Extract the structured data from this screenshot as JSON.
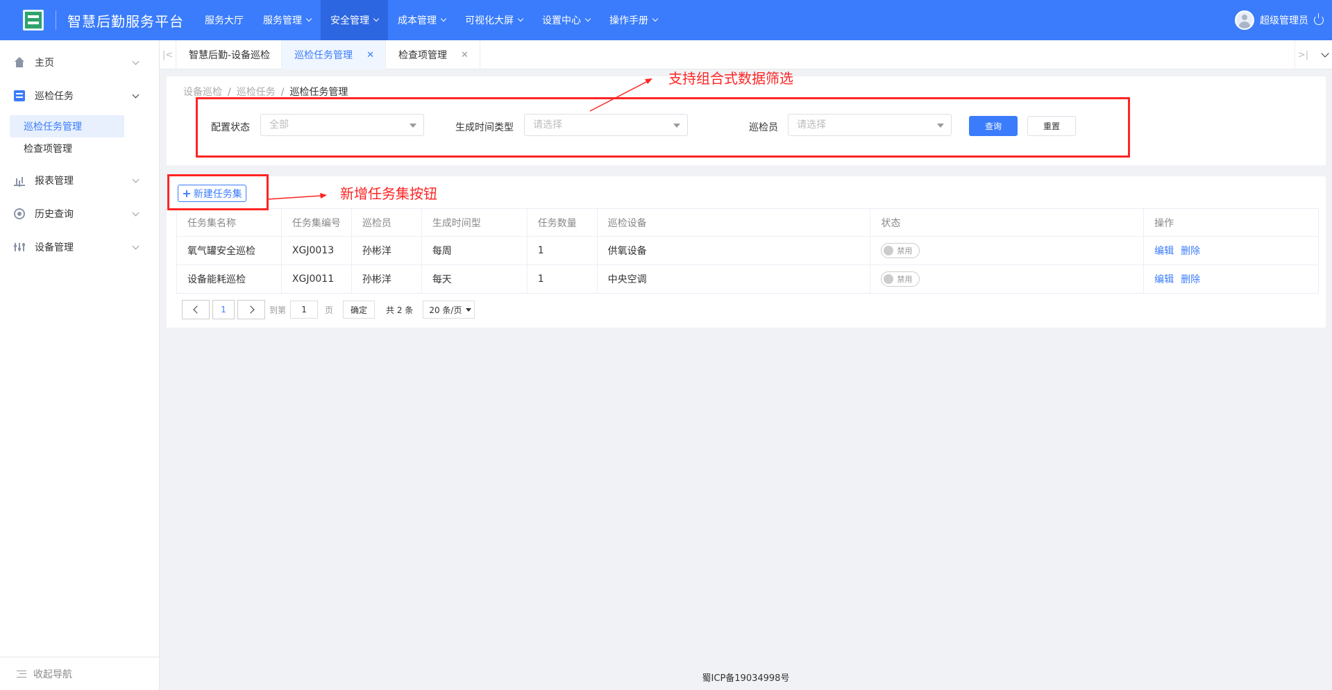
{
  "header": {
    "brand": "智慧后勤服务平台",
    "nav": [
      {
        "label": "服务大厅",
        "dropdown": false,
        "active": false
      },
      {
        "label": "服务管理",
        "dropdown": true,
        "active": false
      },
      {
        "label": "安全管理",
        "dropdown": true,
        "active": true
      },
      {
        "label": "成本管理",
        "dropdown": true,
        "active": false
      },
      {
        "label": "可视化大屏",
        "dropdown": true,
        "active": false
      },
      {
        "label": "设置中心",
        "dropdown": true,
        "active": false
      },
      {
        "label": "操作手册",
        "dropdown": true,
        "active": false
      }
    ],
    "user": "超级管理员",
    "accent_color": "#3a7cfb"
  },
  "sidebar": {
    "items": [
      {
        "label": "主页",
        "icon": "home-icon"
      },
      {
        "label": "巡检任务",
        "icon": "task-icon",
        "open": true,
        "children": [
          {
            "label": "巡检任务管理",
            "active": true
          },
          {
            "label": "检查项管理",
            "active": false
          }
        ]
      },
      {
        "label": "报表管理",
        "icon": "report-icon"
      },
      {
        "label": "历史查询",
        "icon": "history-icon"
      },
      {
        "label": "设备管理",
        "icon": "device-icon"
      }
    ],
    "collapse_label": "收起导航"
  },
  "tabs": [
    {
      "label": "智慧后勤-设备巡检",
      "closable": false,
      "active": false
    },
    {
      "label": "巡检任务管理",
      "closable": true,
      "active": true
    },
    {
      "label": "检查项管理",
      "closable": true,
      "active": false
    }
  ],
  "breadcrumb": [
    "设备巡检",
    "巡检任务",
    "巡检任务管理"
  ],
  "filters": {
    "config_status": {
      "label": "配置状态",
      "value": "全部"
    },
    "time_type": {
      "label": "生成时间类型",
      "placeholder": "请选择"
    },
    "inspector": {
      "label": "巡检员",
      "placeholder": "请选择"
    },
    "query_label": "查询",
    "reset_label": "重置"
  },
  "table": {
    "add_button": "新建任务集",
    "columns": [
      "任务集名称",
      "任务集编号",
      "巡检员",
      "生成时间型",
      "任务数量",
      "巡检设备",
      "状态",
      "操作"
    ],
    "rows": [
      {
        "name": "氧气罐安全巡检",
        "code": "XGJ0013",
        "inspector": "孙彬洋",
        "time_type": "每周",
        "count": "1",
        "device": "供氧设备",
        "status": "禁用",
        "edit": "编辑",
        "delete": "删除"
      },
      {
        "name": "设备能耗巡检",
        "code": "XGJ0011",
        "inspector": "孙彬洋",
        "time_type": "每天",
        "count": "1",
        "device": "中央空调",
        "status": "禁用",
        "edit": "编辑",
        "delete": "删除"
      }
    ]
  },
  "pagination": {
    "current_page": "1",
    "goto_prefix": "到第",
    "goto_value": "1",
    "goto_suffix": "页",
    "confirm": "确定",
    "total": "共 2 条",
    "page_size": "20 条/页"
  },
  "annotations": {
    "filter_note": "支持组合式数据筛选",
    "add_note": "新增任务集按钮",
    "color": "#ff2424"
  },
  "footer": "蜀ICP备19034998号"
}
